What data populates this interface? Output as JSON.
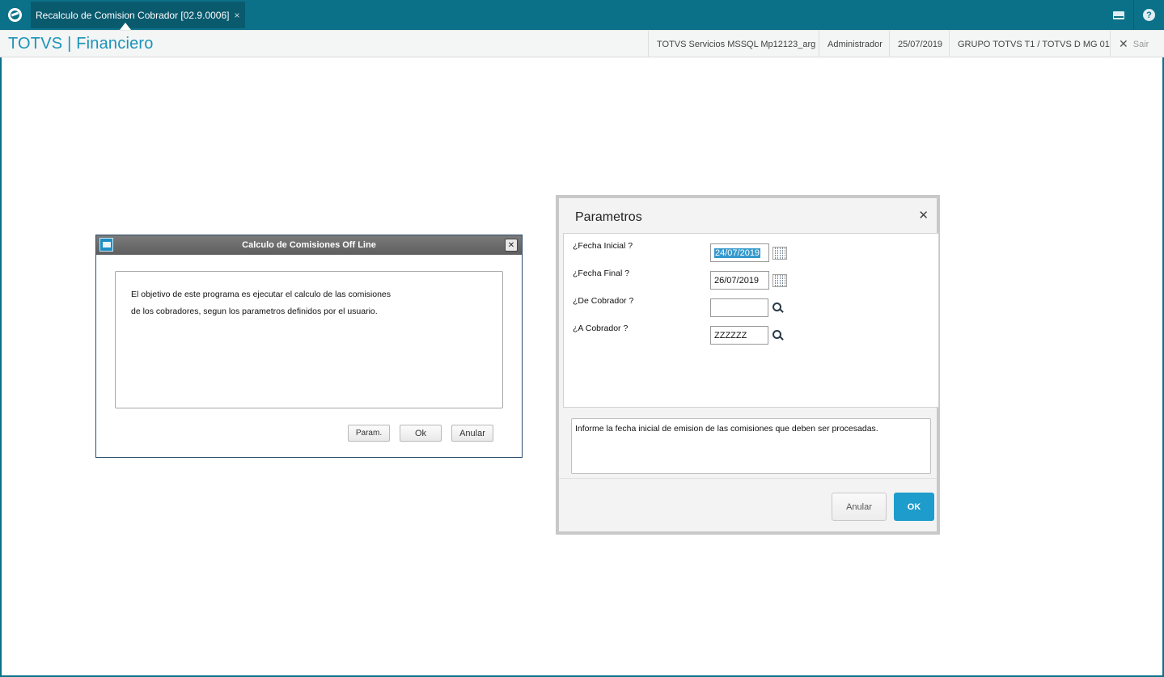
{
  "topbar": {
    "tab_label": "Recalculo de Comision Cobrador [02.9.0006]",
    "tab_close": "×",
    "icons": [
      "totvs-logo-icon",
      "mail-icon",
      "help-icon"
    ]
  },
  "header": {
    "brand": "TOTVS | Financiero",
    "server": "TOTVS Servicios MSSQL Mp12123_arg",
    "user": "Administrador",
    "date": "25/07/2019",
    "group": "GRUPO TOTVS T1 / TOTVS D MG 01",
    "exit_label": "Sair"
  },
  "dialog_calculo": {
    "title": "Calculo de Comisiones Off Line",
    "description_line1": "El objetivo de este programa es ejecutar el calculo de las comisiones",
    "description_line2": "de los cobradores, segun los parametros definidos por el usuario.",
    "buttons": {
      "param": "Param.",
      "ok": "Ok",
      "anular": "Anular"
    }
  },
  "dialog_parametros": {
    "title": "Parametros",
    "fields": [
      {
        "label": "¿Fecha Inicial ?",
        "value": "24/07/2019",
        "selected": true,
        "icon": "calendar-icon"
      },
      {
        "label": "¿Fecha Final ?",
        "value": "26/07/2019",
        "icon": "calendar-icon"
      },
      {
        "label": "¿De Cobrador ?",
        "value": "",
        "icon": "search-icon"
      },
      {
        "label": "¿A Cobrador ?",
        "value": "ZZZZZZ",
        "icon": "search-icon"
      }
    ],
    "help_text": "Informe la fecha inicial de emision de las comisiones que deben ser procesadas.",
    "buttons": {
      "anular": "Anular",
      "ok": "OK"
    }
  },
  "colors": {
    "topbar": "#0b7189",
    "brand_text": "#1a94b8",
    "ok_button": "#1e9ccb",
    "selection": "#3399cc"
  }
}
